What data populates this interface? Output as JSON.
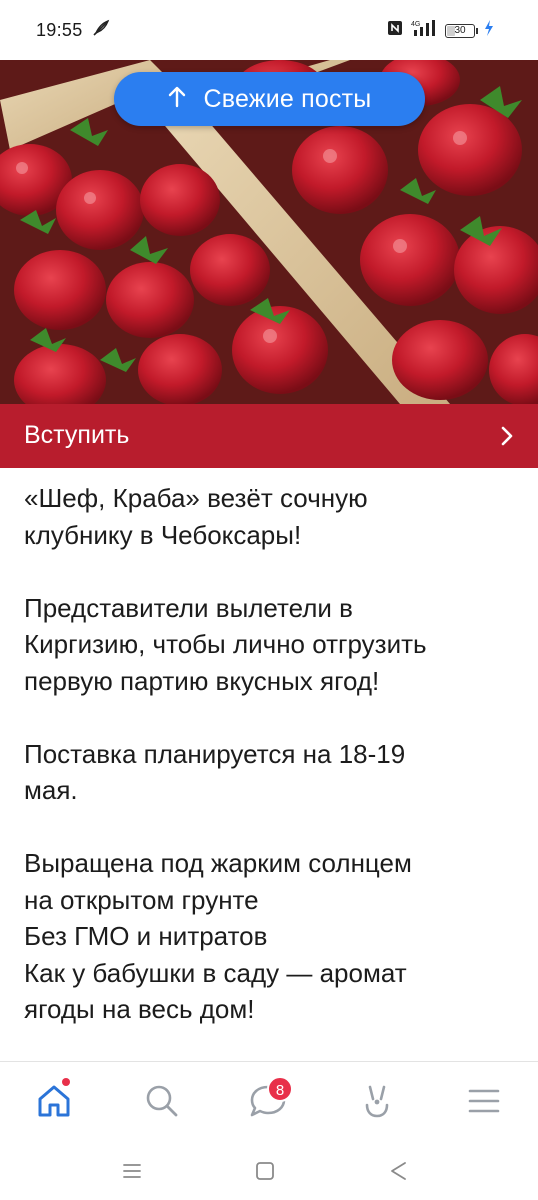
{
  "status_bar": {
    "time": "19:55",
    "battery_level": "30",
    "battery_fraction": 0.3,
    "network": "4G"
  },
  "fresh_posts": {
    "label": "Свежие посты",
    "icon": "arrow-up-icon"
  },
  "join_bar": {
    "label": "Вступить",
    "icon": "chevron-right-icon"
  },
  "post": {
    "lines": [
      "«Шеф, Краба» везёт сочную",
      "клубнику в Чебоксары!",
      "",
      "Представители вылетели в",
      "Киргизию, чтобы лично отгрузить",
      "первую партию вкусных ягод!",
      "",
      "Поставка планируется на 18-19",
      "мая.",
      "",
      "Выращена под жарким солнцем",
      "на открытом грунте",
      "Без ГМО и нитратов",
      "Как у бабушки в саду — аромат",
      "ягоды на весь дом!"
    ]
  },
  "bottom_nav": {
    "items": [
      {
        "icon": "home-icon",
        "has_dot": true
      },
      {
        "icon": "search-icon"
      },
      {
        "icon": "messages-icon",
        "badge": "8"
      },
      {
        "icon": "services-icon"
      },
      {
        "icon": "menu-icon"
      }
    ]
  },
  "colors": {
    "accent_blue": "#2b7ef0",
    "join_red": "#b81d2d",
    "badge_red": "#e8304a",
    "nav_icon": "#9aa0a8",
    "nav_active": "#2b74d8"
  }
}
